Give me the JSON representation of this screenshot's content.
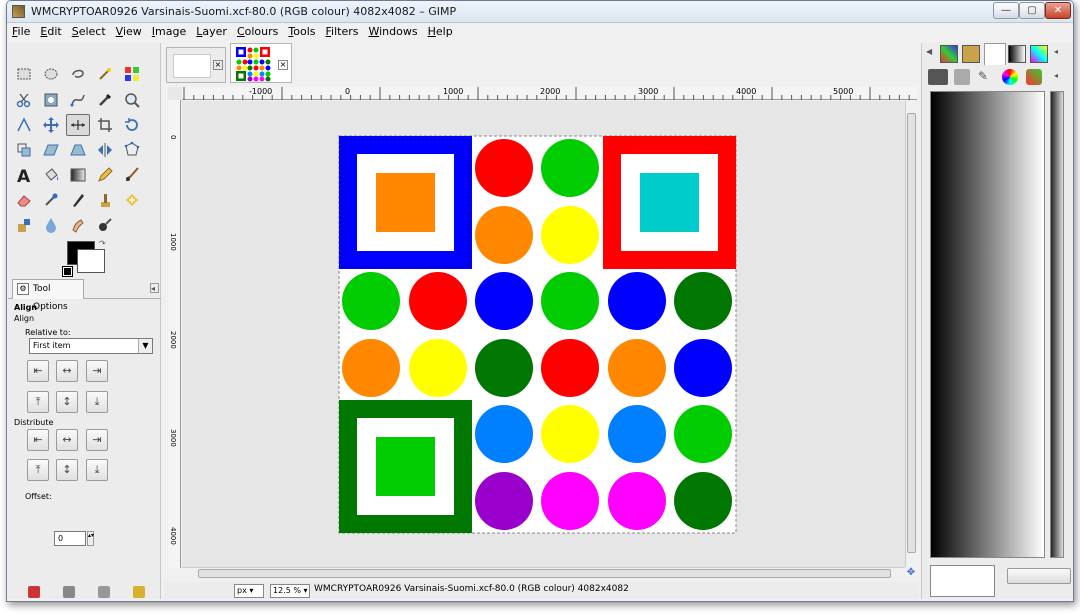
{
  "window": {
    "title": "WMCRYPTOAR0926 Varsinais-Suomi.xcf-80.0 (RGB colour) 4082x4082 – GIMP",
    "controls": [
      "—",
      "▢",
      "✕"
    ]
  },
  "menu": [
    "File",
    "Edit",
    "Select",
    "View",
    "Image",
    "Layer",
    "Colours",
    "Tools",
    "Filters",
    "Windows",
    "Help"
  ],
  "tool_options": {
    "tab_label": "Tool Options",
    "tool_name": "Align",
    "section": "Align",
    "relative_label": "Relative to:",
    "relative_value": "First item",
    "distribute_label": "Distribute",
    "offset_label": "Offset:",
    "offset_value": "0"
  },
  "ruler": {
    "h_labels": [
      "-1000",
      "0",
      "1000",
      "2000",
      "3000",
      "4000",
      "5000"
    ],
    "v_labels": [
      "0",
      "1000",
      "2000",
      "3000",
      "4000"
    ]
  },
  "status": {
    "unit": "px",
    "zoom": "12.5 %",
    "text": "WMCRYPTOAR0926 Varsinais-Suomi.xcf-80.0 (RGB colour) 4082x4082"
  },
  "artwork": {
    "colors": {
      "blue": "#0000ff",
      "red": "#ff0000",
      "green": "#00cc00",
      "darkgreen": "#007700",
      "orange": "#ff8800",
      "yellow": "#ffff00",
      "cyan": "#00cccc",
      "skyblue": "#0080ff",
      "purple": "#9900cc",
      "magenta": "#ff00ff"
    }
  }
}
